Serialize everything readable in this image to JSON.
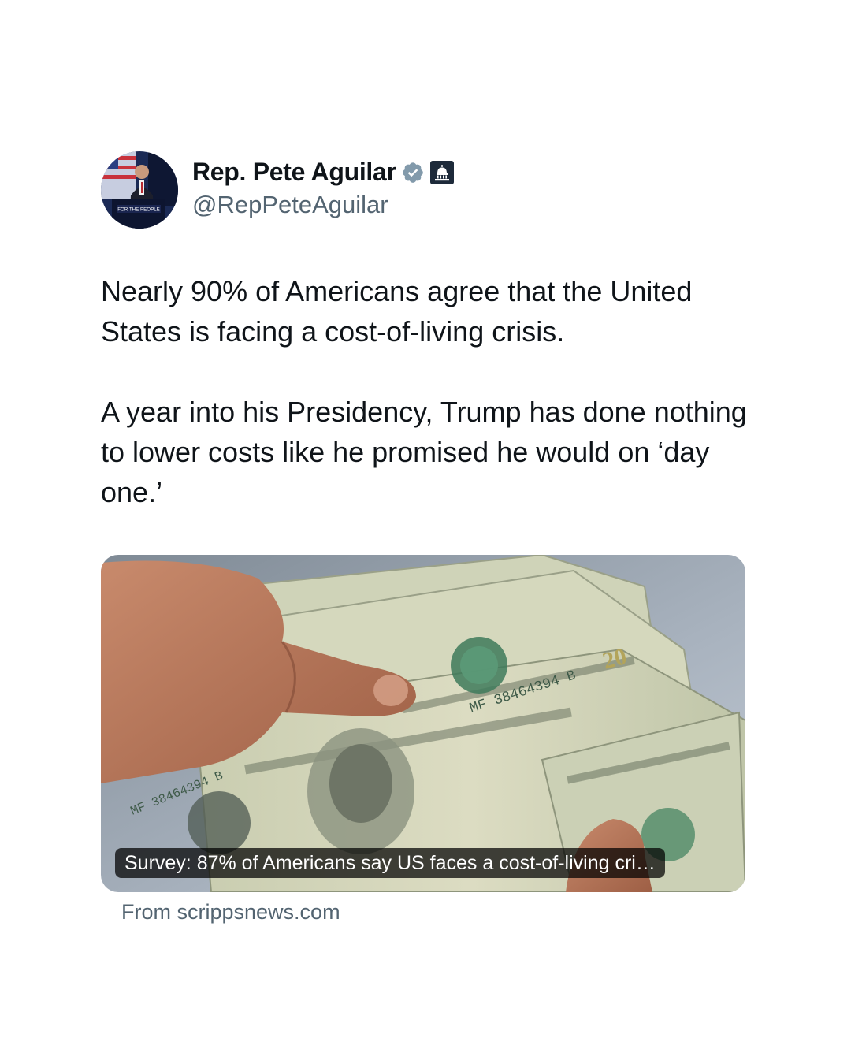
{
  "author": {
    "display_name": "Rep. Pete Aguilar",
    "handle": "@RepPeteAguilar",
    "avatar_sign_text": "FOR THE PEOPLE",
    "verified_icon": "verified-badge-icon",
    "affiliate_icon": "capitol-building-icon"
  },
  "tweet": {
    "paragraphs": [
      "Nearly 90% of Americans agree that the United States is facing a cost-of-living crisis.",
      "A year into his Presidency, Trump has done nothing to lower costs like he promised he would on ‘day one.’"
    ]
  },
  "link_card": {
    "title": "Survey: 87% of Americans say US faces a cost-of-living cri…",
    "source": "From scrippsnews.com",
    "image_icon": "cash-in-hand-image"
  },
  "colors": {
    "text_primary": "#0f1419",
    "text_secondary": "#536471",
    "verified_badge": "#829aab",
    "affiliate_badge": "#1d2a3a"
  }
}
